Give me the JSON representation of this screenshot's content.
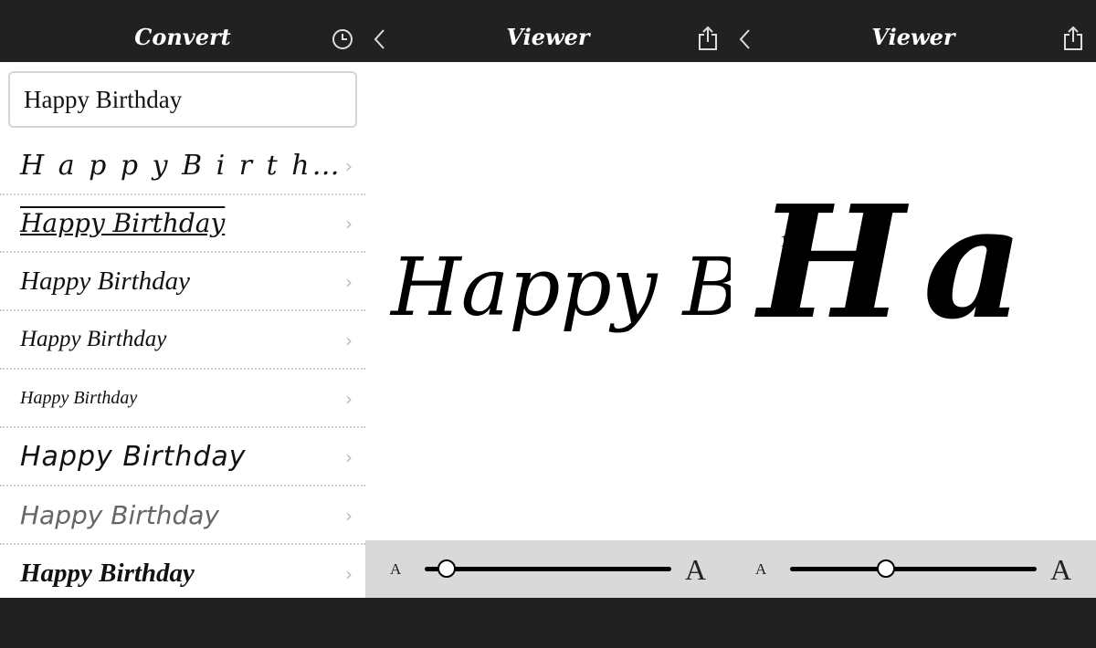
{
  "convert": {
    "title": "Convert",
    "history_icon": "clock-icon",
    "input_value": "Happy Birthday",
    "rows": [
      {
        "label": "Happy Birthday",
        "display": "H a p p y  B i r t h…"
      },
      {
        "label": "Happy Birthday",
        "display": "Happy Birthday"
      },
      {
        "label": "Happy Birthday",
        "display": "Happy Birthday"
      },
      {
        "label": "Happy Birthday",
        "display": "Happy Birthday"
      },
      {
        "label": "Happy Birthday",
        "display": "Happy Birthday"
      },
      {
        "label": "Happy Birthday",
        "display": "Happy Birthday"
      },
      {
        "label": "Happy Birthday",
        "display": "Happy Birthday"
      },
      {
        "label": "Happy Birthday",
        "display": "Happy Birthday"
      }
    ]
  },
  "viewer1": {
    "title": "Viewer",
    "text": "Happy Birthday",
    "slider_value": 0.09,
    "small_a": "A",
    "large_a": "A"
  },
  "viewer2": {
    "title": "Viewer",
    "text": "Ha",
    "stroke_number": "1",
    "slider_value": 0.39,
    "small_a": "A",
    "large_a": "A"
  }
}
